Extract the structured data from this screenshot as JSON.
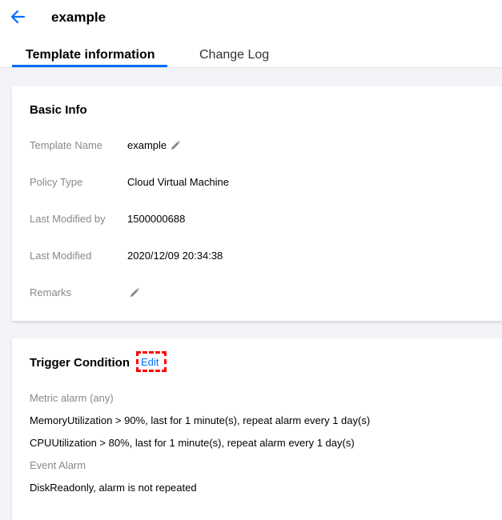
{
  "header": {
    "title": "example",
    "tabs": [
      {
        "label": "Template information",
        "active": true
      },
      {
        "label": "Change Log",
        "active": false
      }
    ]
  },
  "basic_info": {
    "title": "Basic Info",
    "rows": [
      {
        "label": "Template Name",
        "value": "example"
      },
      {
        "label": "Policy Type",
        "value": "Cloud Virtual Machine"
      },
      {
        "label": "Last Modified by",
        "value": "1500000688"
      },
      {
        "label": "Last Modified",
        "value": "2020/12/09 20:34:38"
      },
      {
        "label": "Remarks",
        "value": ""
      }
    ]
  },
  "trigger": {
    "title": "Trigger Condition",
    "edit_label": "Edit",
    "metric_heading": "Metric alarm (any)",
    "metric_rules": [
      "MemoryUtilization > 90%, last for 1 minute(s), repeat alarm every 1 day(s)",
      "CPUUtilization > 80%, last for 1 minute(s), repeat alarm every 1 day(s)"
    ],
    "event_heading": "Event Alarm",
    "event_rules": [
      "DiskReadonly, alarm is not repeated"
    ]
  },
  "colors": {
    "accent": "#006eff",
    "highlight": "#ff0000"
  }
}
